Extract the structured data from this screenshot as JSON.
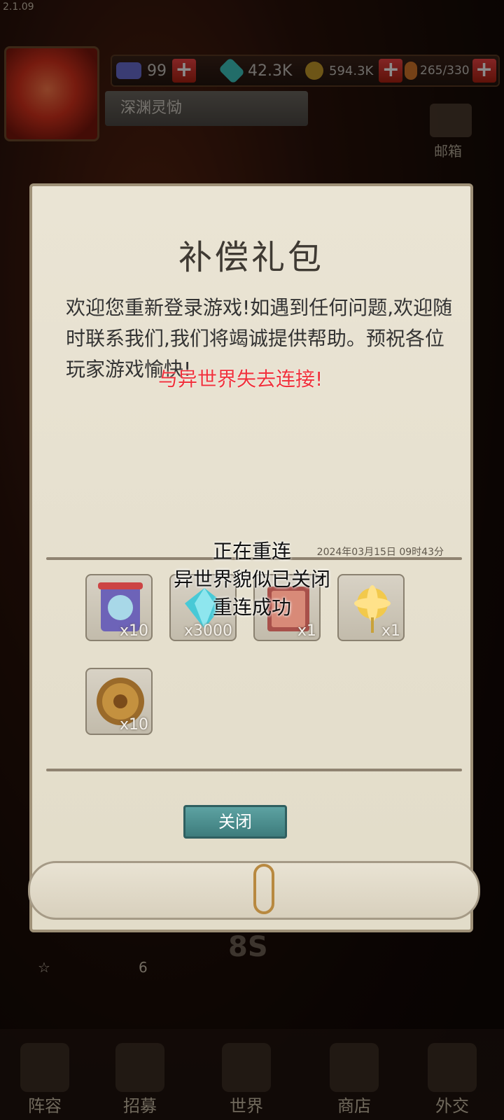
{
  "version": "2.1.09",
  "resources": {
    "tickets": "99",
    "diamonds": "42.3K",
    "gold": "594.3K",
    "stamina": "265/330",
    "plus": "+"
  },
  "player_name": "深渊灵恸",
  "mail_label": "邮箱",
  "dialog": {
    "title": "补偿礼包",
    "body": "欢迎您重新登录游戏!如遇到任何问题,欢迎随时联系我们,我们将竭诚提供帮助。预祝各位玩家游戏愉快!",
    "date": "2024年03月15日 09时43分",
    "items": [
      {
        "icon": "scroll-icon",
        "qty": "x10"
      },
      {
        "icon": "diamond-icon",
        "qty": "x3000"
      },
      {
        "icon": "book-icon",
        "qty": "x1"
      },
      {
        "icon": "golden-flower-icon",
        "qty": "x1"
      },
      {
        "icon": "coin-medal-icon",
        "qty": "x10"
      }
    ],
    "close_label": "关闭"
  },
  "overlay": {
    "disconnect": "与异世界失去连接!",
    "reconnecting": "正在重连",
    "closed": "异世界貌似已关闭",
    "success": "重连成功"
  },
  "background": {
    "timer": "8S",
    "card_count": "6"
  },
  "nav": [
    "阵容",
    "招募",
    "世界",
    "商店",
    "外交"
  ],
  "colors": {
    "accent_button": "#4a8c8c",
    "warning": "#f0323c",
    "plus_button": "#d03a2a"
  }
}
